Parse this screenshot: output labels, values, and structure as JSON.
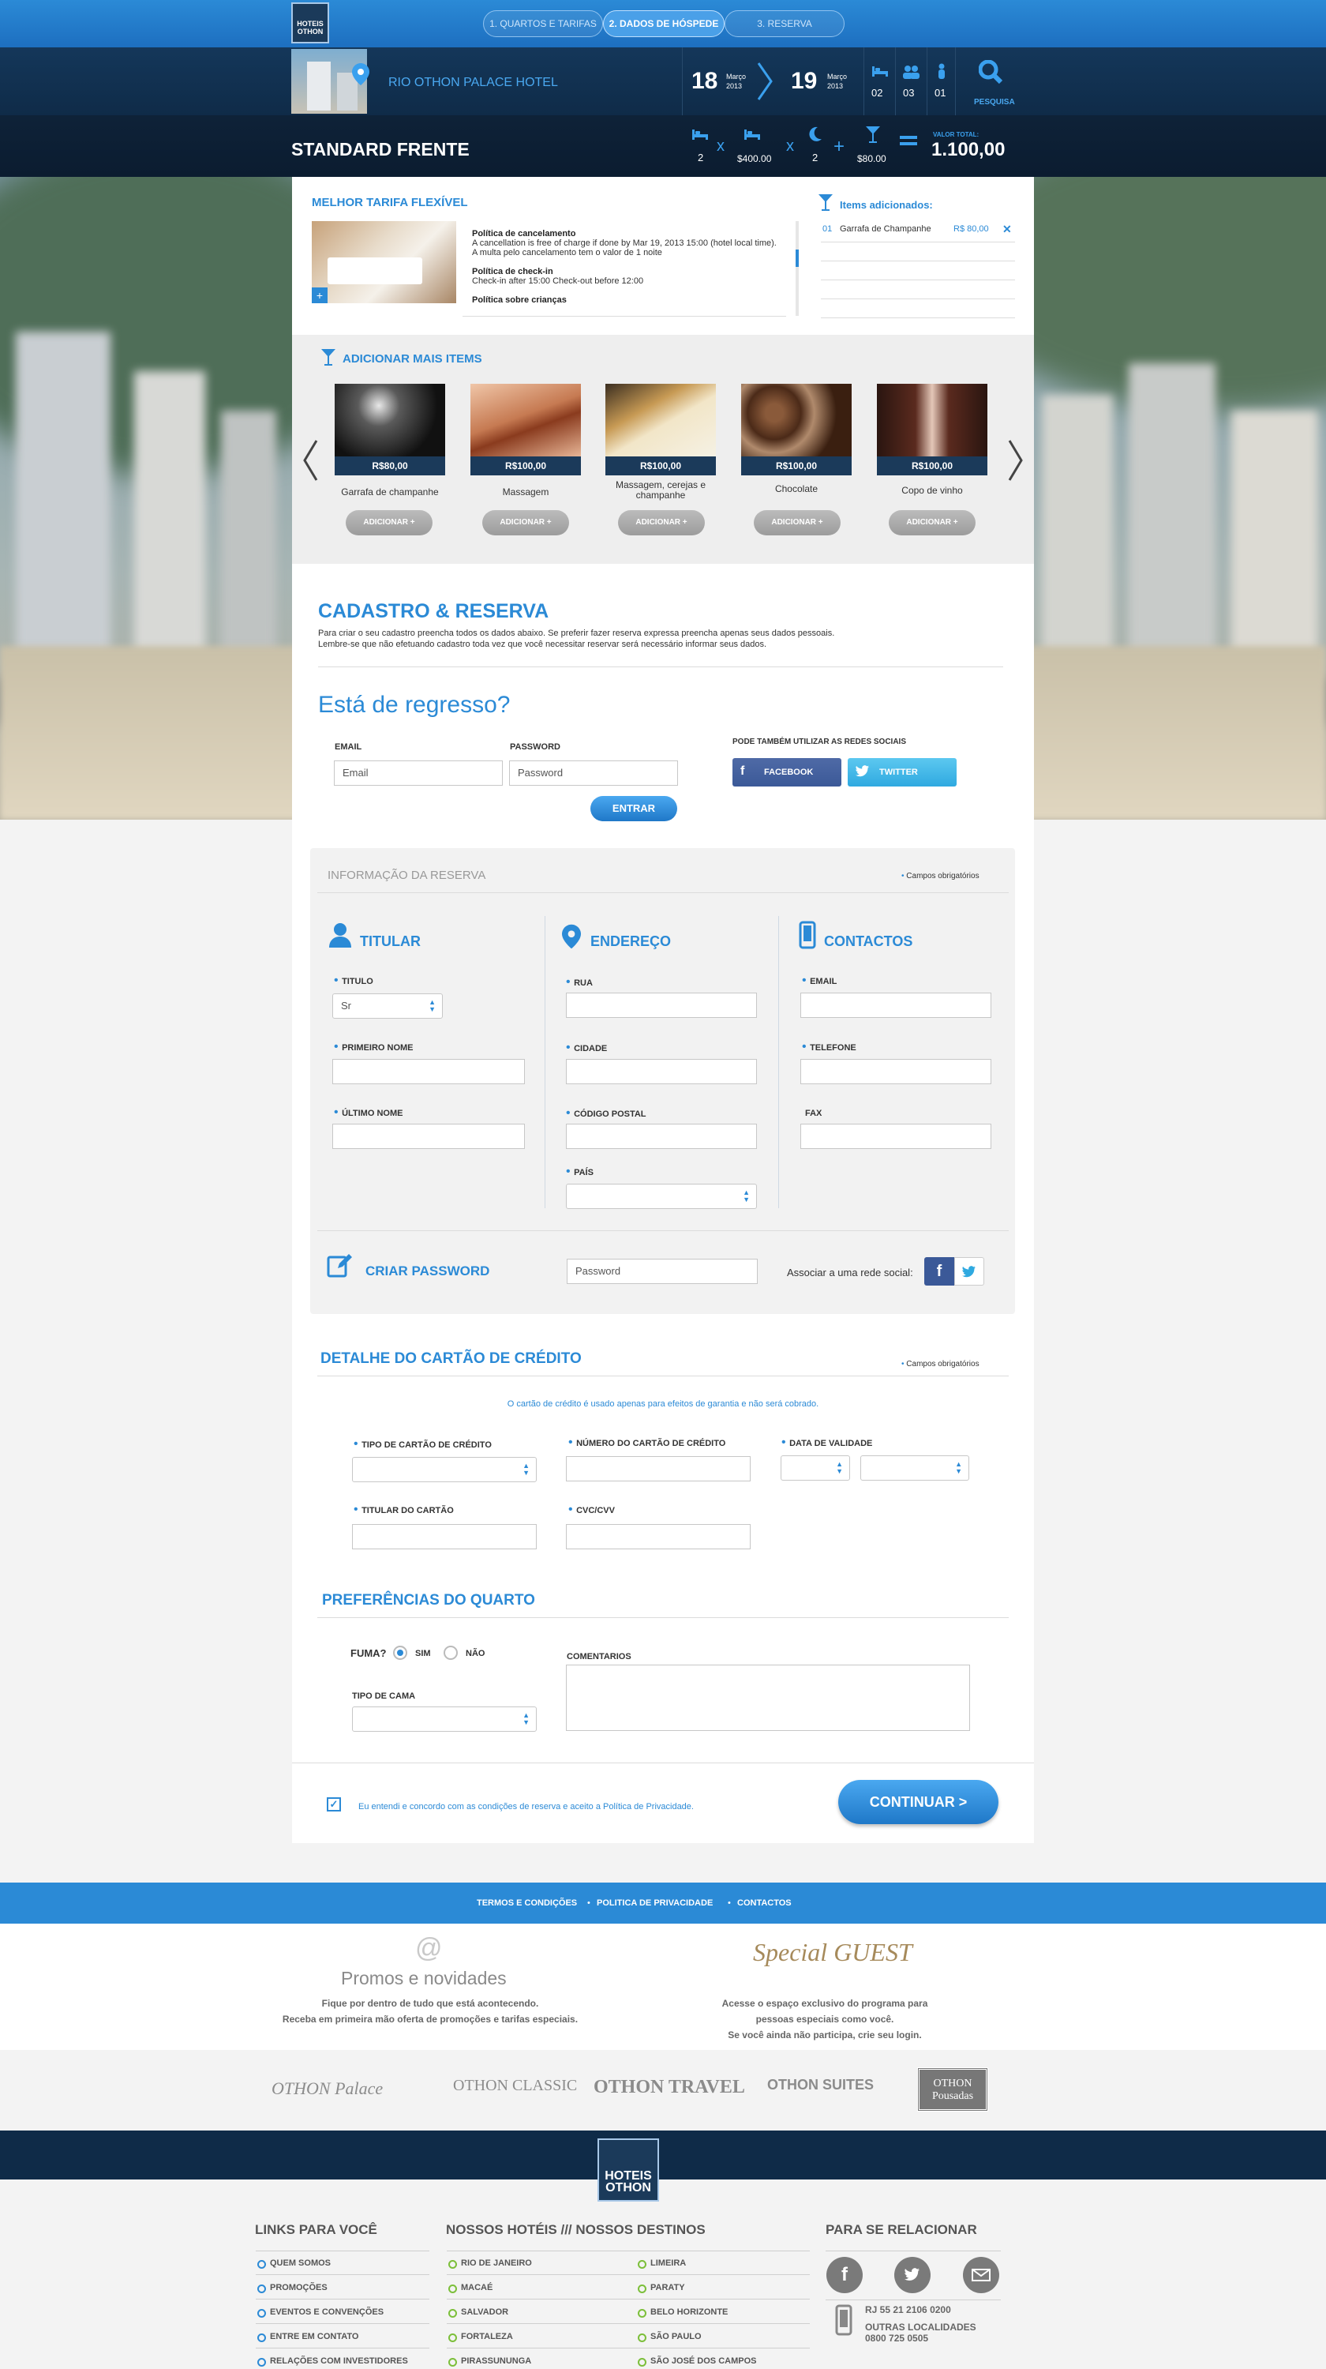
{
  "steps": [
    {
      "label": "1. QUARTOS E TARIFAS"
    },
    {
      "label": "2. DADOS DE HÓSPEDE"
    },
    {
      "label": "3. RESERVA"
    }
  ],
  "header": {
    "logo_text": "HOTEIS OTHON",
    "hotel_name": "RIO OTHON PALACE HOTEL",
    "checkin_day": "18",
    "checkin_month": "Março",
    "checkin_year": "2013",
    "checkout_day": "19",
    "checkout_month": "Março",
    "checkout_year": "2013",
    "rooms": "02",
    "adults": "03",
    "children": "01",
    "search_label": "PESQUISA"
  },
  "room": {
    "title": "STANDARD FRENTE",
    "rooms_count": "2",
    "price_per_night": "$400.00",
    "nights": "2",
    "extras": "$80.00",
    "total_label": "VALOR TOTAL:",
    "total_value": "1.100,00"
  },
  "rate": {
    "title": "MELHOR TARIFA FLEXÍVEL",
    "cancel_title": "Política de cancelamento",
    "cancel_text": "A cancellation is free of charge if done by Mar 19, 2013 15:00 (hotel local time). A multa pelo cancelamento tem o valor de 1 noite",
    "checkin_title": "Política de check-in",
    "checkin_text": "Check-in after 15:00 Check-out before 12:00",
    "children_title": "Política sobre crianças"
  },
  "added": {
    "title": "Items adicionados:",
    "items": [
      {
        "num": "01",
        "name": "Garrafa de Champanhe",
        "price": "R$ 80,00"
      }
    ]
  },
  "more": {
    "title": "ADICIONAR MAIS ITEMS",
    "add_label": "ADICIONAR",
    "items": [
      {
        "name": "Garrafa de champanhe",
        "price": "R$80,00"
      },
      {
        "name": "Massagem",
        "price": "R$100,00"
      },
      {
        "name": "Massagem, cerejas e champanhe",
        "price": "R$100,00"
      },
      {
        "name": "Chocolate",
        "price": "R$100,00"
      },
      {
        "name": "Copo de vinho",
        "price": "R$100,00"
      }
    ]
  },
  "register": {
    "title": "CADASTRO & RESERVA",
    "text1": "Para criar o seu cadastro preencha todos os dados abaixo. Se preferir fazer reserva expressa preencha apenas seus dados pessoais.",
    "text2": "Lembre-se que não efetuando cadastro toda vez que você necessitar reservar será necessário informar seus dados."
  },
  "login": {
    "title": "Está de regresso?",
    "email_label": "EMAIL",
    "email_placeholder": "Email",
    "password_label": "PASSWORD",
    "password_placeholder": "Password",
    "enter": "ENTRAR",
    "social_label": "PODE TAMBÉM UTILIZAR AS REDES SOCIAIS",
    "facebook": "FACEBOOK",
    "twitter": "TWITTER"
  },
  "reservation": {
    "title": "INFORMAÇÃO DA RESERVA",
    "required": "Campos obrigatórios",
    "titular": "TITULAR",
    "endereco": "ENDEREÇO",
    "contactos": "CONTACTOS",
    "titulo_label": "TITULO",
    "titulo_value": "Sr",
    "first_name": "PRIMEIRO NOME",
    "last_name": "ÚLTIMO NOME",
    "rua": "RUA",
    "cidade": "CIDADE",
    "postal": "CÓDIGO POSTAL",
    "pais": "PAÍS",
    "email": "EMAIL",
    "telefone": "TELEFONE",
    "fax": "FAX",
    "create_password": "CRIAR PASSWORD",
    "password_placeholder": "Password",
    "associate": "Associar a uma rede social:"
  },
  "card": {
    "title": "DETALHE DO CARTÃO DE CRÉDITO",
    "required": "Campos obrigatórios",
    "note": "O cartão de crédito é usado apenas para efeitos de garantia e não será cobrado.",
    "type": "TIPO DE CARTÃO DE CRÉDITO",
    "number": "NÚMERO DO CARTÃO DE CRÉDITO",
    "expiry": "DATA DE VALIDADE",
    "holder": "TITULAR DO CARTÃO",
    "cvc": "CVC/CVV"
  },
  "prefs": {
    "title": "PREFERÊNCIAS DO QUARTO",
    "smoke": "FUMA?",
    "yes": "SIM",
    "no": "NÃO",
    "bed": "TIPO DE CAMA",
    "comments": "COMENTARIOS"
  },
  "terms": {
    "text": "Eu entendi e concordo com as condições de reserva e aceito a Política de Privacidade.",
    "continue": "CONTINUAR >"
  },
  "footer": {
    "links": [
      "TERMOS E CONDIÇÕES",
      "POLITICA DE PRIVACIDADE",
      "CONTACTOS"
    ],
    "promos_title": "Promos e novidades",
    "promos_text1": "Fique por dentro de tudo que está acontecendo.",
    "promos_text2": "Receba em primeira mão oferta de promoções e tarifas especiais.",
    "special_guest": "Special GUEST",
    "sg_text1": "Acesse o espaço exclusivo do programa para",
    "sg_text2": "pessoas especiais como você.",
    "sg_text3": "Se você ainda não participa, crie seu login.",
    "brands": [
      "OTHON Palace",
      "OTHON CLASSIC",
      "OTHON TRAVEL",
      "OTHON SUITES",
      "OTHON Pousadas"
    ],
    "logo": "HOTEIS OTHON",
    "col1_title": "LINKS PARA VOCÊ",
    "col1": [
      "QUEM SOMOS",
      "PROMOÇÕES",
      "EVENTOS E CONVENÇÕES",
      "ENTRE EM CONTATO",
      "RELAÇÕES COM INVESTIDORES"
    ],
    "col2_title": "NOSSOS HOTÉIS /// NOSSOS DESTINOS",
    "col2a": [
      "RIO DE JANEIRO",
      "MACAÉ",
      "SALVADOR",
      "FORTALEZA",
      "PIRASSUNUNGA"
    ],
    "col2b": [
      "LIMEIRA",
      "PARATY",
      "BELO HORIZONTE",
      "SÃO PAULO",
      "SÃO JOSÉ DOS CAMPOS"
    ],
    "col3_title": "PARA SE RELACIONAR",
    "phone1": "RJ 55 21 2106 0200",
    "phone2": "OUTRAS LOCALIDADES",
    "phone3": "0800 725 0505"
  },
  "colors": {
    "accent": "#2b8ad6",
    "dark": "#0f2b48"
  }
}
